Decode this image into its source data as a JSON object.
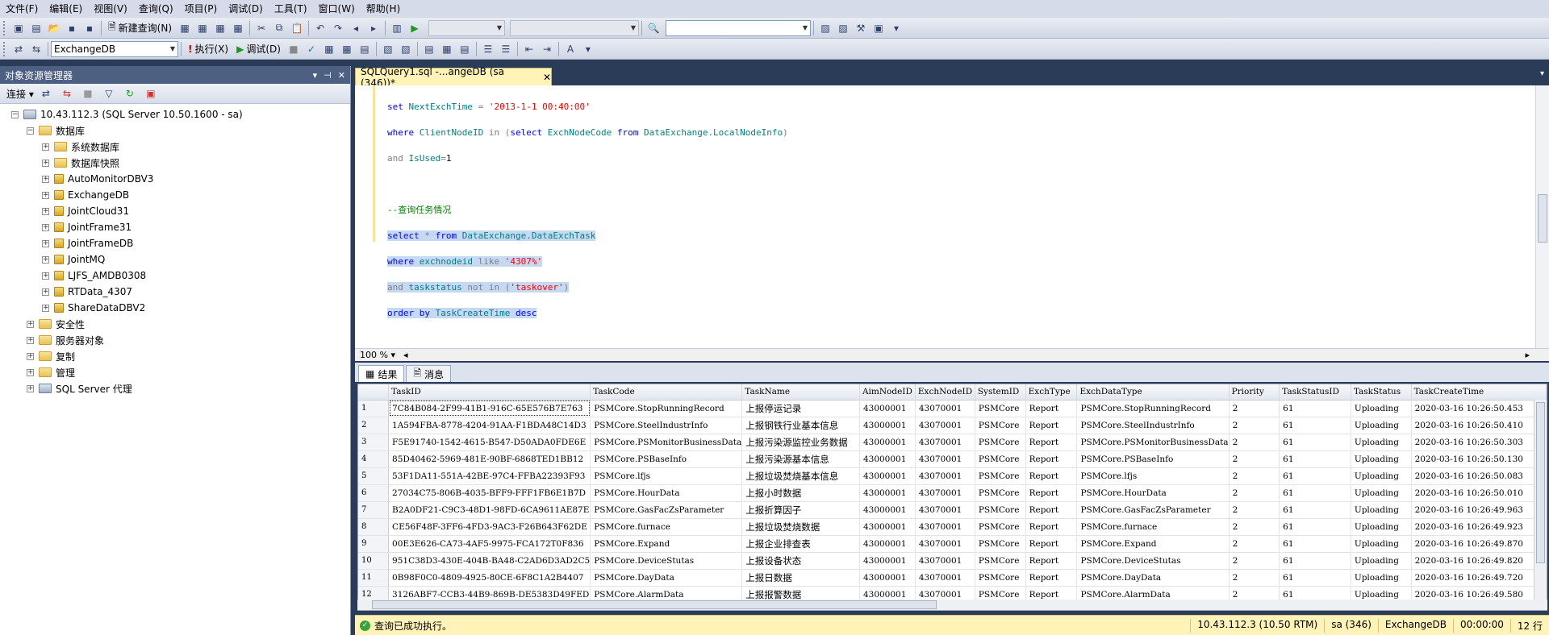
{
  "menu": [
    "文件(F)",
    "编辑(E)",
    "视图(V)",
    "查询(Q)",
    "项目(P)",
    "调试(D)",
    "工具(T)",
    "窗口(W)",
    "帮助(H)"
  ],
  "toolbar1": {
    "new_query": "新建查询(N)"
  },
  "toolbar2": {
    "database": "ExchangeDB",
    "execute": "执行(X)",
    "debug": "调试(D)"
  },
  "object_explorer": {
    "title": "对象资源管理器",
    "connect": "连接",
    "server": "10.43.112.3 (SQL Server 10.50.1600 - sa)",
    "databases_label": "数据库",
    "databases": [
      "系统数据库",
      "数据库快照",
      "AutoMonitorDBV3",
      "ExchangeDB",
      "JointCloud31",
      "JointFrame31",
      "JointFrameDB",
      "JointMQ",
      "LJFS_AMDB0308",
      "RTData_4307",
      "ShareDataDBV2"
    ],
    "top_nodes": [
      "安全性",
      "服务器对象",
      "复制",
      "管理",
      "SQL Server 代理"
    ]
  },
  "editor": {
    "tab_title": "SQLQuery1.sql -...angeDB (sa (346))*",
    "zoom": "100 %"
  },
  "results": {
    "tab_results": "结果",
    "tab_messages": "消息",
    "columns": [
      "TaskID",
      "TaskCode",
      "TaskName",
      "AimNodeID",
      "ExchNodeID",
      "SystemID",
      "ExchType",
      "ExchDataType",
      "Priority",
      "TaskStatusID",
      "TaskStatus",
      "TaskCreateTime"
    ],
    "rows": [
      [
        "1",
        "7C84B084-2F99-41B1-916C-65E576B7E763",
        "PSMCore.StopRunningRecord",
        "上报停运记录",
        "43000001",
        "43070001",
        "PSMCore",
        "Report",
        "PSMCore.StopRunningRecord",
        "2",
        "61",
        "Uploading",
        "2020-03-16 10:26:50.453"
      ],
      [
        "2",
        "1A594FBA-8778-4204-91AA-F1BDA48C14D3",
        "PSMCore.SteelIndustrInfo",
        "上报钢铁行业基本信息",
        "43000001",
        "43070001",
        "PSMCore",
        "Report",
        "PSMCore.SteelIndustrInfo",
        "2",
        "61",
        "Uploading",
        "2020-03-16 10:26:50.410"
      ],
      [
        "3",
        "F5E91740-1542-4615-B547-D50ADA0FDE6E",
        "PSMCore.PSMonitorBusinessData",
        "上报污染源监控业务数据",
        "43000001",
        "43070001",
        "PSMCore",
        "Report",
        "PSMCore.PSMonitorBusinessData",
        "2",
        "61",
        "Uploading",
        "2020-03-16 10:26:50.303"
      ],
      [
        "4",
        "85D40462-5969-481E-90BF-6868TED1BB12",
        "PSMCore.PSBaseInfo",
        "上报污染源基本信息",
        "43000001",
        "43070001",
        "PSMCore",
        "Report",
        "PSMCore.PSBaseInfo",
        "2",
        "61",
        "Uploading",
        "2020-03-16 10:26:50.130"
      ],
      [
        "5",
        "53F1DA11-551A-42BE-97C4-FFBA22393F93",
        "PSMCore.lfjs",
        "上报垃圾焚烧基本信息",
        "43000001",
        "43070001",
        "PSMCore",
        "Report",
        "PSMCore.lfjs",
        "2",
        "61",
        "Uploading",
        "2020-03-16 10:26:50.083"
      ],
      [
        "6",
        "27034C75-806B-4035-BFF9-FFF1FB6E1B7D",
        "PSMCore.HourData",
        "上报小时数据",
        "43000001",
        "43070001",
        "PSMCore",
        "Report",
        "PSMCore.HourData",
        "2",
        "61",
        "Uploading",
        "2020-03-16 10:26:50.010"
      ],
      [
        "7",
        "B2A0DF21-C9C3-48D1-98FD-6CA9611AE87E",
        "PSMCore.GasFacZsParameter",
        "上报折算因子",
        "43000001",
        "43070001",
        "PSMCore",
        "Report",
        "PSMCore.GasFacZsParameter",
        "2",
        "61",
        "Uploading",
        "2020-03-16 10:26:49.963"
      ],
      [
        "8",
        "CE56F48F-3FF6-4FD3-9AC3-F26B643F62DE",
        "PSMCore.furnace",
        "上报垃圾焚烧数据",
        "43000001",
        "43070001",
        "PSMCore",
        "Report",
        "PSMCore.furnace",
        "2",
        "61",
        "Uploading",
        "2020-03-16 10:26:49.923"
      ],
      [
        "9",
        "00E3E626-CA73-4AF5-9975-FCA172T0F836",
        "PSMCore.Expand",
        "上报企业排查表",
        "43000001",
        "43070001",
        "PSMCore",
        "Report",
        "PSMCore.Expand",
        "2",
        "61",
        "Uploading",
        "2020-03-16 10:26:49.870"
      ],
      [
        "10",
        "951C38D3-430E-404B-BA48-C2AD6D3AD2C5",
        "PSMCore.DeviceStutas",
        "上报设备状态",
        "43000001",
        "43070001",
        "PSMCore",
        "Report",
        "PSMCore.DeviceStutas",
        "2",
        "61",
        "Uploading",
        "2020-03-16 10:26:49.820"
      ],
      [
        "11",
        "0B98F0C0-4809-4925-80CE-6F8C1A2B4407",
        "PSMCore.DayData",
        "上报日数据",
        "43000001",
        "43070001",
        "PSMCore",
        "Report",
        "PSMCore.DayData",
        "2",
        "61",
        "Uploading",
        "2020-03-16 10:26:49.720"
      ],
      [
        "12",
        "3126ABF7-CCB3-44B9-869B-DE5383D49FED",
        "PSMCore.AlarmData",
        "上报报警数据",
        "43000001",
        "43070001",
        "PSMCore",
        "Report",
        "PSMCore.AlarmData",
        "2",
        "61",
        "Uploading",
        "2020-03-16 10:26:49.580"
      ]
    ]
  },
  "status": {
    "message": "查询已成功执行。",
    "server": "10.43.112.3 (10.50 RTM)",
    "user": "sa (346)",
    "database": "ExchangeDB",
    "elapsed": "00:00:00",
    "rows": "12 行"
  }
}
